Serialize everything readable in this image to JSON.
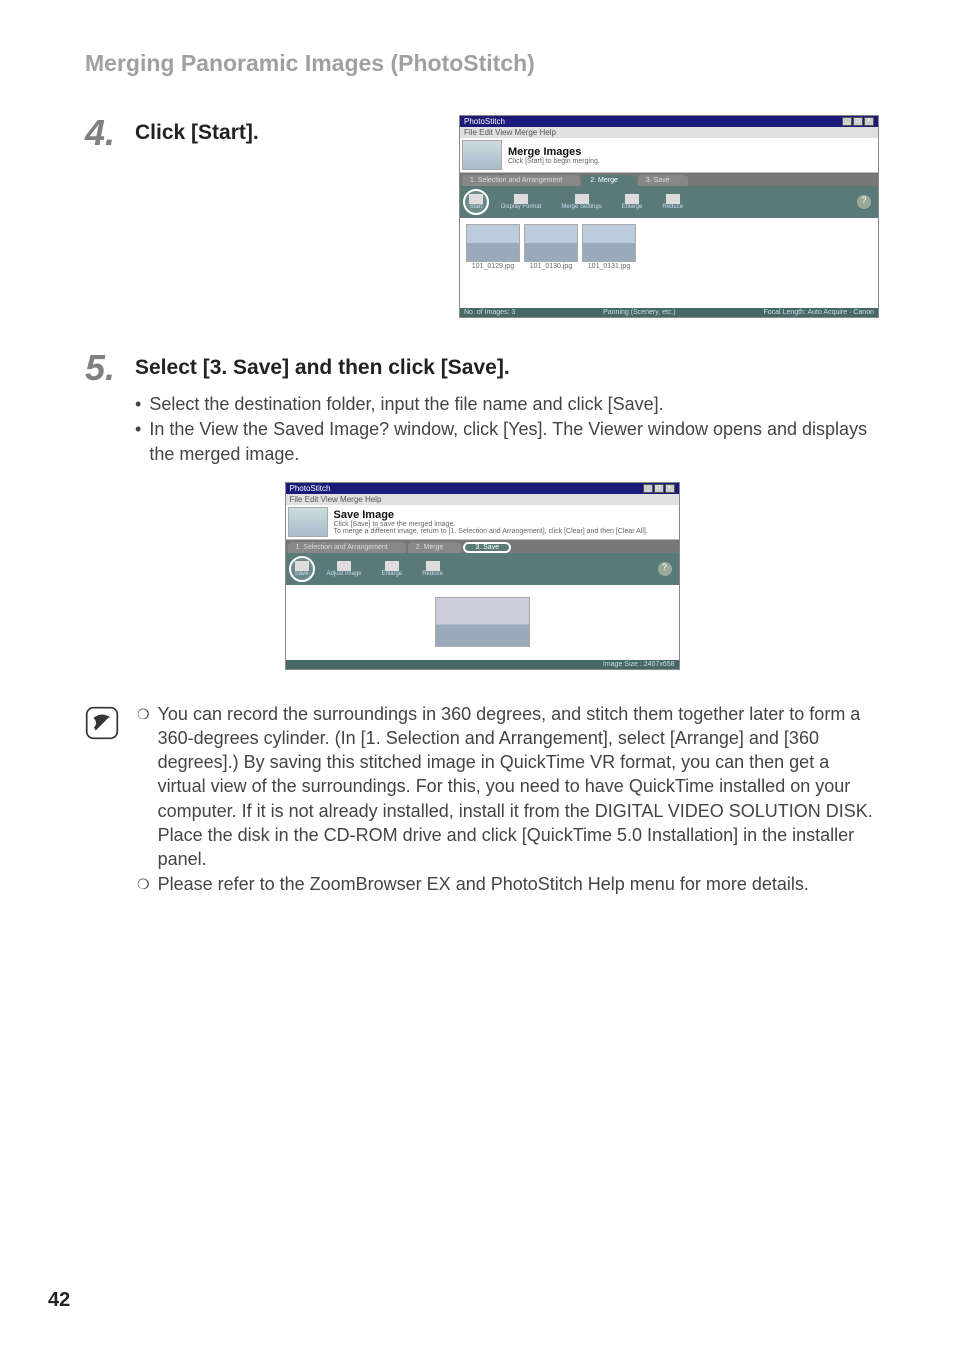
{
  "header": {
    "title": "Merging Panoramic Images (PhotoStitch)"
  },
  "step4": {
    "num": "4.",
    "title": "Click [Start]."
  },
  "step5": {
    "num": "5.",
    "title": "Select [3. Save] and then click [Save].",
    "bullets": [
      "Select the destination folder, input the file name and click [Save].",
      "In the View the Saved Image? window, click [Yes]. The Viewer window opens and displays the merged image."
    ]
  },
  "mergeWindow": {
    "appTitle": "PhotoStitch",
    "menu": "File  Edit  View  Merge  Help",
    "sectionTitle": "Merge Images",
    "sectionSub": "Click [Start] to begin merging.",
    "tabs": [
      "1. Selection and Arrangement",
      "2. Merge",
      "3. Save"
    ],
    "tools": {
      "start": "Start",
      "display": "Display Format",
      "mergeSettings": "Merge Settings",
      "enlarge": "Enlarge",
      "reduce": "Reduce"
    },
    "images": [
      "101_0129.jpg",
      "101_0130.jpg",
      "101_0131.jpg"
    ],
    "statusLeft": "No. of Images: 3",
    "statusMid": "Panning (Scenery, etc.)",
    "statusRight": "Focal Length: Auto Acquire · Canon"
  },
  "saveWindow": {
    "appTitle": "PhotoStitch",
    "menu": "File  Edit  View  Merge  Help",
    "sectionTitle": "Save Image",
    "sectionSub1": "Click [Save] to save the merged image.",
    "sectionSub2": "To merge a different image, return to [1. Selection and Arrangement], click [Clear] and then [Clear All].",
    "tabs": [
      "1. Selection and Arrangement",
      "2. Merge",
      "3. Save"
    ],
    "tools": {
      "save": "Save",
      "adjust": "Adjust Image",
      "enlarge": "Enlarge",
      "reduce": "Reduce"
    },
    "statusRight": "Image Size : 2407x658"
  },
  "notes": {
    "items": [
      "You can record the surroundings in 360 degrees, and stitch them together later to form a 360-degrees cylinder. (In [1. Selection and Arrangement], select [Arrange] and [360 degrees].) By saving this stitched image in QuickTime VR format, you can then get a virtual view of the surroundings. For this, you need to have QuickTime installed on your computer.  If it is not already installed, install it from the DIGITAL VIDEO SOLUTION DISK.  Place the disk in the CD-ROM drive and click [QuickTime 5.0 Installation] in the installer panel.",
      "Please refer to the ZoomBrowser EX and PhotoStitch Help menu for more details."
    ]
  },
  "pageNumber": "42"
}
